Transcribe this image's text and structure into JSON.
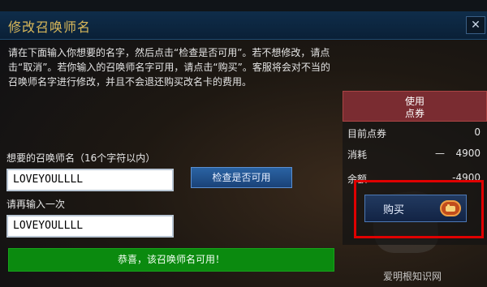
{
  "window": {
    "title": "修改召唤师名",
    "close_glyph": "✕"
  },
  "description": "请在下面输入你想要的名字，然后点击“检查是否可用”。若不想修改，请点击“取消”。若你输入的召唤师名字可用，请点击“购买”。客服将会对不当的召唤师名字进行修改，并且不会退还购买改名卡的费用。",
  "form": {
    "name_label": "想要的召唤师名（16个字符以内）",
    "name_value": "LOVEYOULLLL",
    "repeat_label": "请再输入一次",
    "repeat_value": "LOVEYOULLLL",
    "check_button": "检查是否可用",
    "success_message": "恭喜，该召唤师名可用！"
  },
  "price_panel": {
    "header_line1": "使用",
    "header_line2": "点券",
    "rows": [
      {
        "label": "目前点券",
        "value": "0"
      },
      {
        "label": "消耗",
        "dash": "—",
        "value": "4900"
      },
      {
        "label": "余额",
        "value": "-4900"
      }
    ],
    "buy_button": "购买",
    "accent_color": "#e00000"
  },
  "watermark": "爱明根知识网",
  "icons": {
    "close": "close-icon",
    "buy": "fist-coin-icon"
  }
}
